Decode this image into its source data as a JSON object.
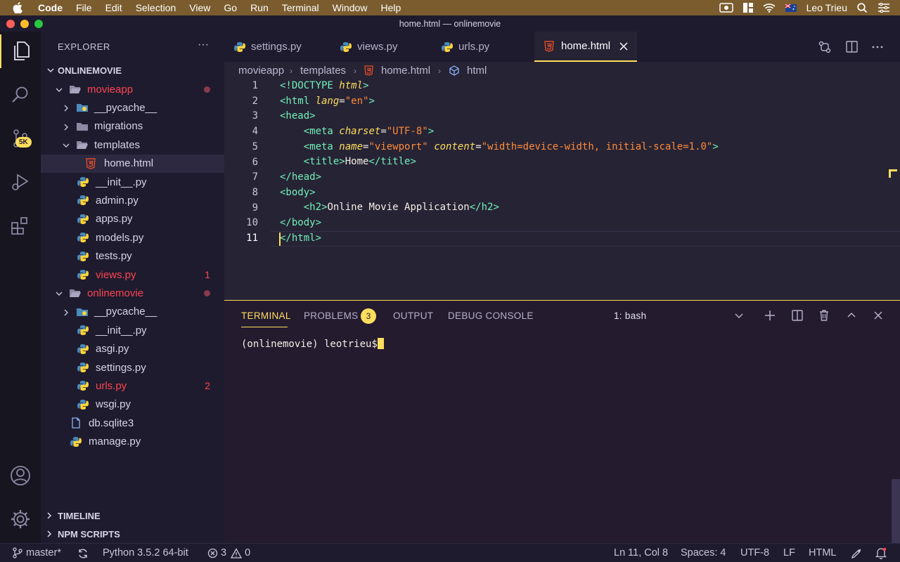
{
  "menubar": {
    "app": "Code",
    "items": [
      "File",
      "Edit",
      "Selection",
      "View",
      "Go",
      "Run",
      "Terminal",
      "Window",
      "Help"
    ],
    "user": "Leo Trieu"
  },
  "window": {
    "title": "home.html — onlinemovie"
  },
  "activity": {
    "scm_badge": "5K"
  },
  "sidebar": {
    "title": "EXPLORER",
    "more": "···",
    "root": "ONLINEMOVIE",
    "tree": [
      {
        "label": "movieapp",
        "depth": 1,
        "folder": true,
        "open": true,
        "color": "red",
        "modified": true
      },
      {
        "label": "__pycache__",
        "depth": 2,
        "folder": true,
        "open": false
      },
      {
        "label": "migrations",
        "depth": 2,
        "folder": true,
        "open": false
      },
      {
        "label": "templates",
        "depth": 2,
        "folder": true,
        "open": true
      },
      {
        "label": "home.html",
        "depth": 3,
        "folder": false,
        "icon": "html",
        "selected": true
      },
      {
        "label": "__init__.py",
        "depth": 2,
        "folder": false,
        "icon": "python"
      },
      {
        "label": "admin.py",
        "depth": 2,
        "folder": false,
        "icon": "python"
      },
      {
        "label": "apps.py",
        "depth": 2,
        "folder": false,
        "icon": "python"
      },
      {
        "label": "models.py",
        "depth": 2,
        "folder": false,
        "icon": "python"
      },
      {
        "label": "tests.py",
        "depth": 2,
        "folder": false,
        "icon": "python"
      },
      {
        "label": "views.py",
        "depth": 2,
        "folder": false,
        "icon": "python",
        "color": "red",
        "count": "1"
      },
      {
        "label": "onlinemovie",
        "depth": 1,
        "folder": true,
        "open": true,
        "color": "red",
        "modified": true
      },
      {
        "label": "__pycache__",
        "depth": 2,
        "folder": true,
        "open": false
      },
      {
        "label": "__init__.py",
        "depth": 2,
        "folder": false,
        "icon": "python"
      },
      {
        "label": "asgi.py",
        "depth": 2,
        "folder": false,
        "icon": "python"
      },
      {
        "label": "settings.py",
        "depth": 2,
        "folder": false,
        "icon": "python"
      },
      {
        "label": "urls.py",
        "depth": 2,
        "folder": false,
        "icon": "python",
        "color": "red",
        "count": "2"
      },
      {
        "label": "wsgi.py",
        "depth": 2,
        "folder": false,
        "icon": "python"
      },
      {
        "label": "db.sqlite3",
        "depth": 1,
        "folder": false,
        "icon": "file"
      },
      {
        "label": "manage.py",
        "depth": 1,
        "folder": false,
        "icon": "python"
      }
    ],
    "timeline": "TIMELINE",
    "npm": "NPM SCRIPTS"
  },
  "tabs": [
    {
      "label": "settings.py",
      "icon": "python"
    },
    {
      "label": "views.py",
      "icon": "python"
    },
    {
      "label": "urls.py",
      "icon": "python"
    },
    {
      "label": "home.html",
      "icon": "html",
      "active": true
    }
  ],
  "breadcrumbs": [
    "movieapp",
    "templates",
    "home.html",
    "html"
  ],
  "editor": {
    "lines": [
      "1",
      "2",
      "3",
      "4",
      "5",
      "6",
      "7",
      "8",
      "9",
      "10",
      "11"
    ]
  },
  "panel": {
    "tabs": [
      "TERMINAL",
      "PROBLEMS",
      "OUTPUT",
      "DEBUG CONSOLE"
    ],
    "problems_count": "3",
    "shell": "1: bash",
    "prompt": "(onlinemovie) leotrieu$"
  },
  "status": {
    "branch": "master*",
    "python": "Python 3.5.2 64-bit",
    "errors": "3",
    "warnings": "0",
    "position": "Ln 11, Col 8",
    "spaces": "Spaces: 4",
    "encoding": "UTF-8",
    "eol": "LF",
    "language": "HTML"
  }
}
